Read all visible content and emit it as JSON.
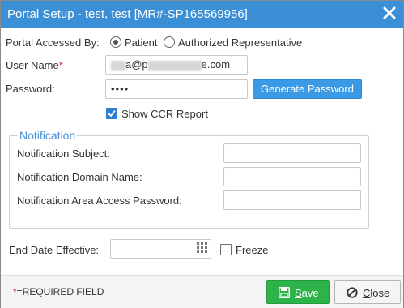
{
  "dialog": {
    "title": "Portal Setup - test, test [MR#-SP165569956]"
  },
  "portal_accessed": {
    "label": "Portal Accessed By:",
    "options": [
      {
        "label": "Patient",
        "selected": true
      },
      {
        "label": "Authorized Representative",
        "selected": false
      }
    ]
  },
  "user_name": {
    "label": "User Name",
    "required_mark": "*",
    "value_prefix": "",
    "value_mid": "a@p",
    "value_suffix": "e.com"
  },
  "password": {
    "label": "Password:",
    "value": "••••",
    "generate_label": "Generate Password"
  },
  "show_ccr": {
    "label": "Show CCR Report",
    "checked": true
  },
  "notification": {
    "legend": "Notification",
    "subject_label": "Notification Subject:",
    "subject_value": "",
    "domain_label": "Notification Domain Name:",
    "domain_value": "",
    "password_label": "Notification Area Access Password:",
    "password_value": ""
  },
  "end_date": {
    "label": "End Date Effective:",
    "value": "",
    "icon": "calendar-icon"
  },
  "freeze": {
    "label": "Freeze",
    "checked": false
  },
  "footer": {
    "required_note_mark": "*",
    "required_note": "=REQUIRED FIELD",
    "save_hotkey": "S",
    "save_rest": "ave",
    "close_hotkey": "C",
    "close_rest": "lose"
  },
  "colors": {
    "title_bar": "#3a8fd6",
    "primary_button": "#3b9ae6",
    "save_button": "#2db34a",
    "legend_text": "#4a90d9",
    "required": "#d9232d"
  }
}
